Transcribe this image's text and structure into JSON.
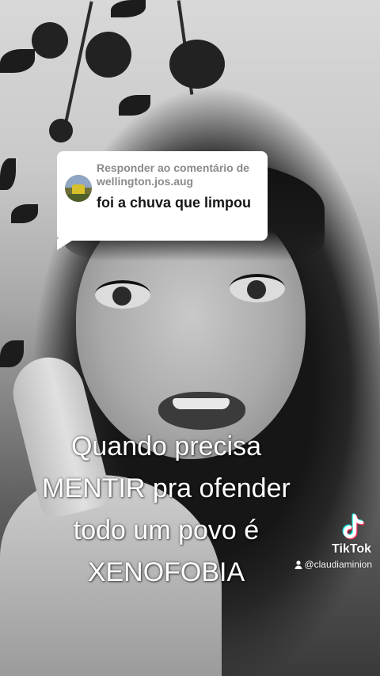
{
  "reply_bubble": {
    "header": "Responder ao comentário de wellington.jos.aug",
    "comment": "foi a chuva que limpou"
  },
  "caption": {
    "lines": [
      "Quando precisa",
      "MENTIR pra ofender",
      "todo um povo é",
      "XENOFOBIA"
    ]
  },
  "watermark": {
    "brand": "TikTok",
    "username": "@claudiaminion",
    "icons": [
      "tiktok-logo-icon",
      "person-icon"
    ]
  },
  "colors": {
    "bubble_bg": "#ffffff",
    "bubble_header": "#8a8a8a",
    "bubble_text": "#161616",
    "caption_text": "#ffffff",
    "tiktok_cyan": "#25f4ee",
    "tiktok_red": "#fe2c55"
  }
}
